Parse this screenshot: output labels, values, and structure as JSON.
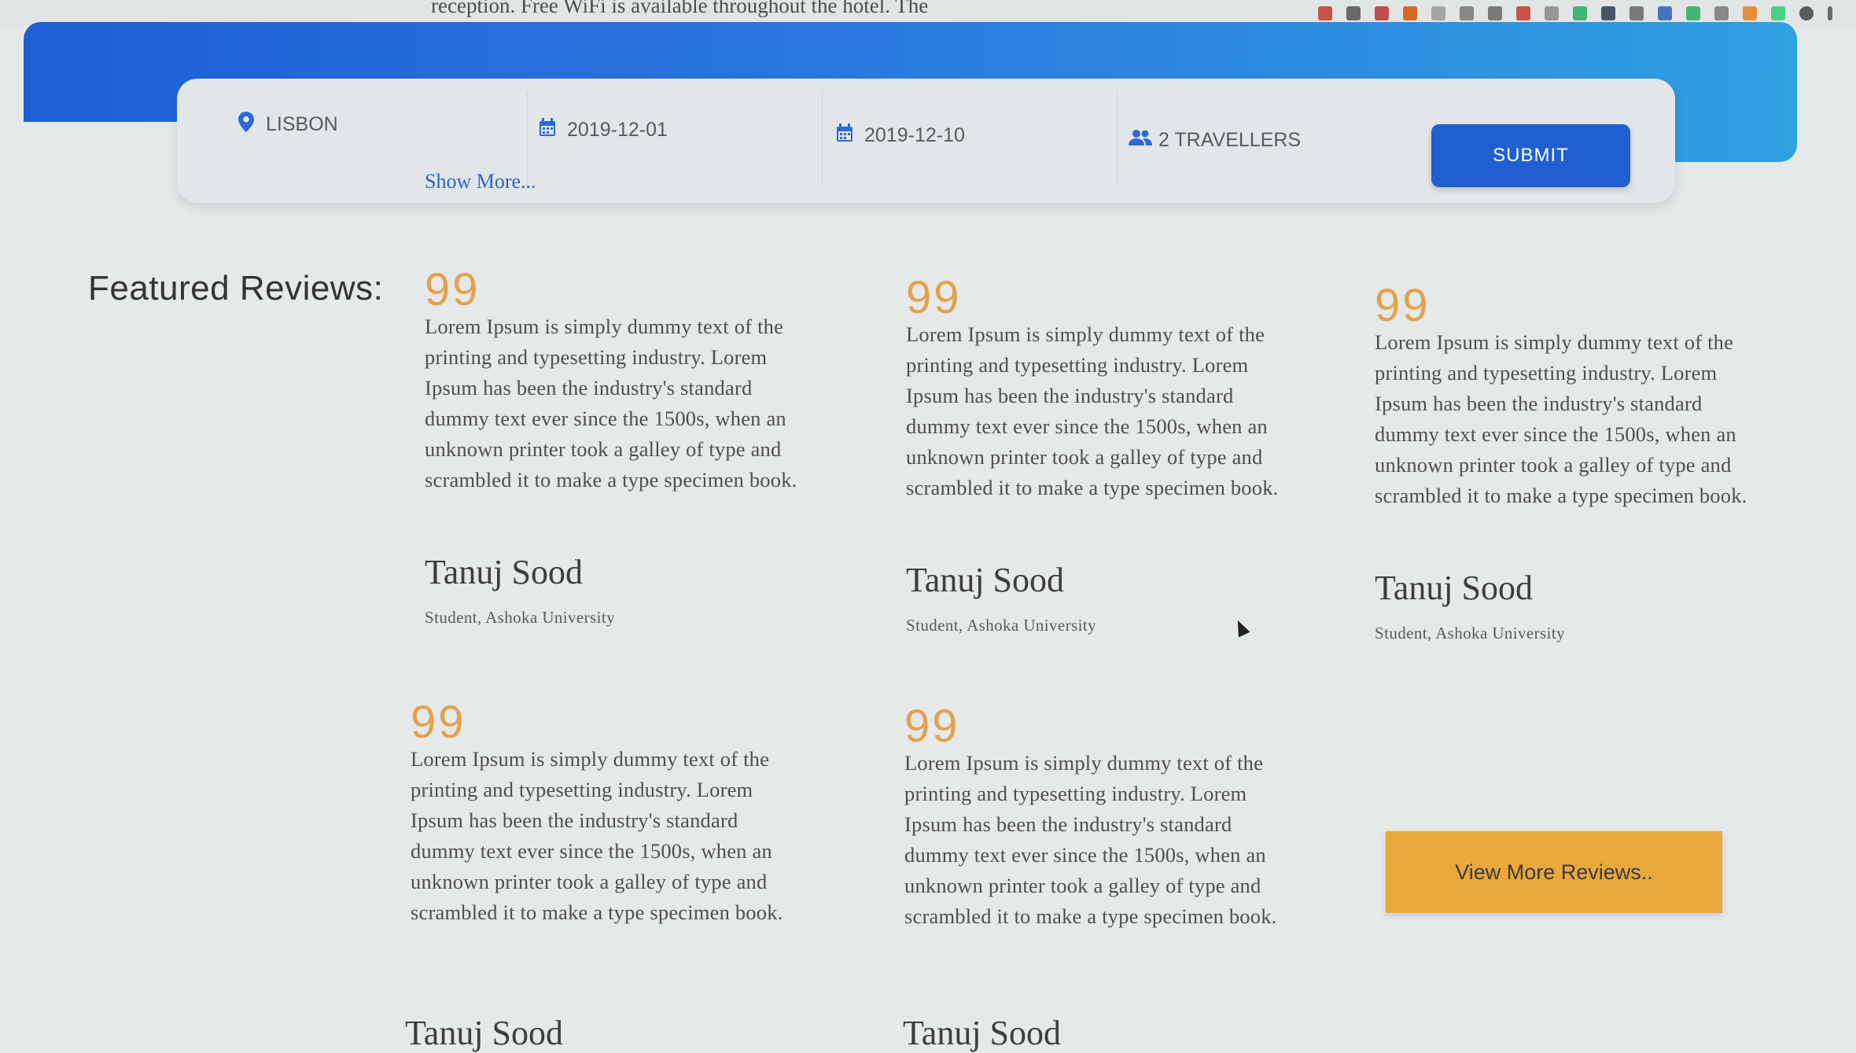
{
  "top_text": "reception. Free WiFi is available throughout the hotel. The",
  "search": {
    "location": "LISBON",
    "checkin": "2019-12-01",
    "checkout": "2019-12-10",
    "travellers": "2 TRAVELLERS",
    "submit_label": "SUBMIT",
    "show_more": "Show More..."
  },
  "section_title": "Featured Reviews:",
  "reviews": [
    {
      "quote": "99",
      "text": "Lorem Ipsum is simply dummy text of the printing and typesetting industry. Lorem Ipsum has been the industry's standard dummy text ever since the 1500s, when an unknown printer took a galley of type and scrambled it to make a type specimen book.",
      "name": "Tanuj Sood",
      "role": "Student, Ashoka University"
    },
    {
      "quote": "99",
      "text": "Lorem Ipsum is simply dummy text of the printing and typesetting industry. Lorem Ipsum has been the industry's standard dummy text ever since the 1500s, when an unknown printer took a galley of type and scrambled it to make a type specimen book.",
      "name": "Tanuj Sood",
      "role": "Student, Ashoka University"
    },
    {
      "quote": "99",
      "text": "Lorem Ipsum is simply dummy text of the printing and typesetting industry. Lorem Ipsum has been the industry's standard dummy text ever since the 1500s, when an unknown printer took a galley of type and scrambled it to make a type specimen book.",
      "name": "Tanuj Sood",
      "role": "Student, Ashoka University"
    },
    {
      "quote": "99",
      "text": "Lorem Ipsum is simply dummy text of the printing and typesetting industry. Lorem Ipsum has been the industry's standard dummy text ever since the 1500s, when an unknown printer took a galley of type and scrambled it to make a type specimen book.",
      "name": "Tanuj Sood",
      "role": ""
    },
    {
      "quote": "99",
      "text": "Lorem Ipsum is simply dummy text of the printing and typesetting industry. Lorem Ipsum has been the industry's standard dummy text ever since the 1500s, when an unknown printer took a galley of type and scrambled it to make a type specimen book.",
      "name": "Tanuj Sood",
      "role": ""
    }
  ],
  "view_more_label": "View More Reviews..",
  "colors": {
    "banner": "#1e5fd6",
    "submit": "#1f5fd2",
    "quote": "#e2a24a",
    "view_more": "#e9a93a",
    "background": "#e6e9ea"
  },
  "icons": {
    "location": "map-pin-icon",
    "date": "calendar-icon",
    "travellers": "users-icon"
  }
}
